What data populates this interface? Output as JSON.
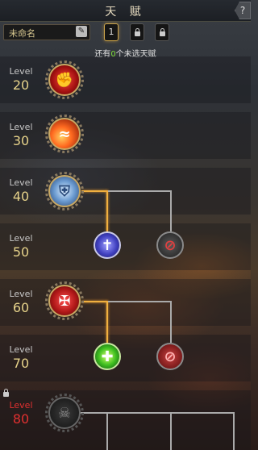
{
  "header": {
    "title": "天 赋",
    "help": "?"
  },
  "toolbar": {
    "name_value": "未命名",
    "edit_icon": "pencil-icon",
    "slots": [
      "1",
      "lock",
      "lock"
    ]
  },
  "remaining": {
    "prefix": "还有",
    "count": "0",
    "suffix": "个未选天赋"
  },
  "levels": [
    {
      "label": "Level",
      "value": "20"
    },
    {
      "label": "Level",
      "value": "30"
    },
    {
      "label": "Level",
      "value": "40"
    },
    {
      "label": "Level",
      "value": "50"
    },
    {
      "label": "Level",
      "value": "60"
    },
    {
      "label": "Level",
      "value": "70"
    },
    {
      "label": "Level",
      "value": "80",
      "locked": true
    }
  ],
  "talents": [
    {
      "name": "rage-fist-icon",
      "state": "selected"
    },
    {
      "name": "fire-slash-icon",
      "state": "selected"
    },
    {
      "name": "shield-icon",
      "state": "selected"
    },
    {
      "name": "holy-shield-icon",
      "state": "selected"
    },
    {
      "name": "forbidden-icon",
      "state": "unselected"
    },
    {
      "name": "blood-fortress-icon",
      "state": "selected"
    },
    {
      "name": "green-heal-icon",
      "state": "selected"
    },
    {
      "name": "forbidden-red-icon",
      "state": "unselected"
    },
    {
      "name": "skull-icon",
      "state": "locked"
    }
  ],
  "colors": {
    "gold": "#e6d28a",
    "accent": "#f0b040",
    "locked": "#e03030",
    "green": "#7fdc3a"
  }
}
